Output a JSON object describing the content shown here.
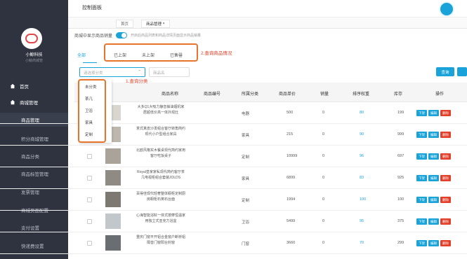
{
  "sidebar": {
    "logo_text": "小鲸科技",
    "logo_sub": "小鲸商城管",
    "items": [
      {
        "label": "首页",
        "type": "top"
      },
      {
        "label": "商城管理",
        "type": "top"
      },
      {
        "label": "商品管理",
        "type": "sub",
        "active": true
      },
      {
        "label": "积分商城管理",
        "type": "sub"
      },
      {
        "label": "商品分类",
        "type": "sub"
      },
      {
        "label": "商品标签管理",
        "type": "sub"
      },
      {
        "label": "发票管理",
        "type": "sub"
      },
      {
        "label": "商城页面配置",
        "type": "sub"
      },
      {
        "label": "支付设置",
        "type": "sub"
      },
      {
        "label": "快递费设置",
        "type": "sub"
      }
    ]
  },
  "topbar": {
    "breadcrumb": "控制面板",
    "tabs": [
      "首页",
      "商品管理"
    ]
  },
  "switch_row": {
    "label": "商城中显示商品销量",
    "hint": "开启后商品列表和商品详情页面显示商品销量"
  },
  "status_tabs": [
    "全部",
    "已上架",
    "未上架",
    "已售罄"
  ],
  "annotations": {
    "query_status": "2.查询商品情况",
    "query_category": "1.查询分类"
  },
  "filters": {
    "category_placeholder": "请选择分类",
    "name_placeholder": "商品名",
    "search_label": "查询"
  },
  "dropdown_options": [
    "未分类",
    "茶几",
    "卫浴",
    "家具",
    "定制"
  ],
  "table": {
    "headers": [
      "商品名称",
      "商品编号",
      "所属分类",
      "商品单价",
      "销量",
      "排序权重",
      "库存",
      "操作"
    ],
    "rows": [
      {
        "name": "大多Q1大吸力静音抽油烟机家居超低价高一体外观灶",
        "category": "电器",
        "price": "500",
        "sales": "0",
        "sort": "80",
        "stock": "199"
      },
      {
        "name": "意式真皮沙发组合客厅转角简约现代小户型组合家具",
        "category": "家具",
        "price": "215",
        "sales": "0",
        "sort": "90",
        "stock": "999"
      },
      {
        "name": "北欧风格实木餐桌现代简约家用客厅吃饭桌子",
        "category": "定制",
        "price": "10999",
        "sales": "0",
        "sort": "96",
        "stock": "697"
      },
      {
        "name": "Royal皇家家私现代简约客厅茶几电视柜组合套装JOLDS",
        "category": "家具",
        "price": "6899",
        "sales": "0",
        "sort": "83",
        "stock": "925"
      },
      {
        "name": "百得佳现代轻奢整体橱柜定制厨房橱柜石英石台面",
        "category": "定制",
        "price": "1994",
        "sales": "0",
        "sort": "100",
        "stock": "100"
      },
      {
        "name": "心海智能浴缸一体式按摩恒温家用独立式亚克力浴盆",
        "category": "卫浴",
        "price": "5499",
        "sales": "0",
        "sort": "95",
        "stock": "375"
      },
      {
        "name": "重庆门窗平开铝合金窗户断桥铝隔音门窗阳台封窗",
        "category": "门窗",
        "price": "3660",
        "sales": "0",
        "sort": "70",
        "stock": "299"
      }
    ],
    "actions": [
      "下架",
      "编辑",
      "删除"
    ]
  },
  "colors": {
    "accent": "#1aa3d8",
    "danger": "#e2402a",
    "annotation": "#e8732a",
    "sidebar_bg": "#2f3340"
  }
}
